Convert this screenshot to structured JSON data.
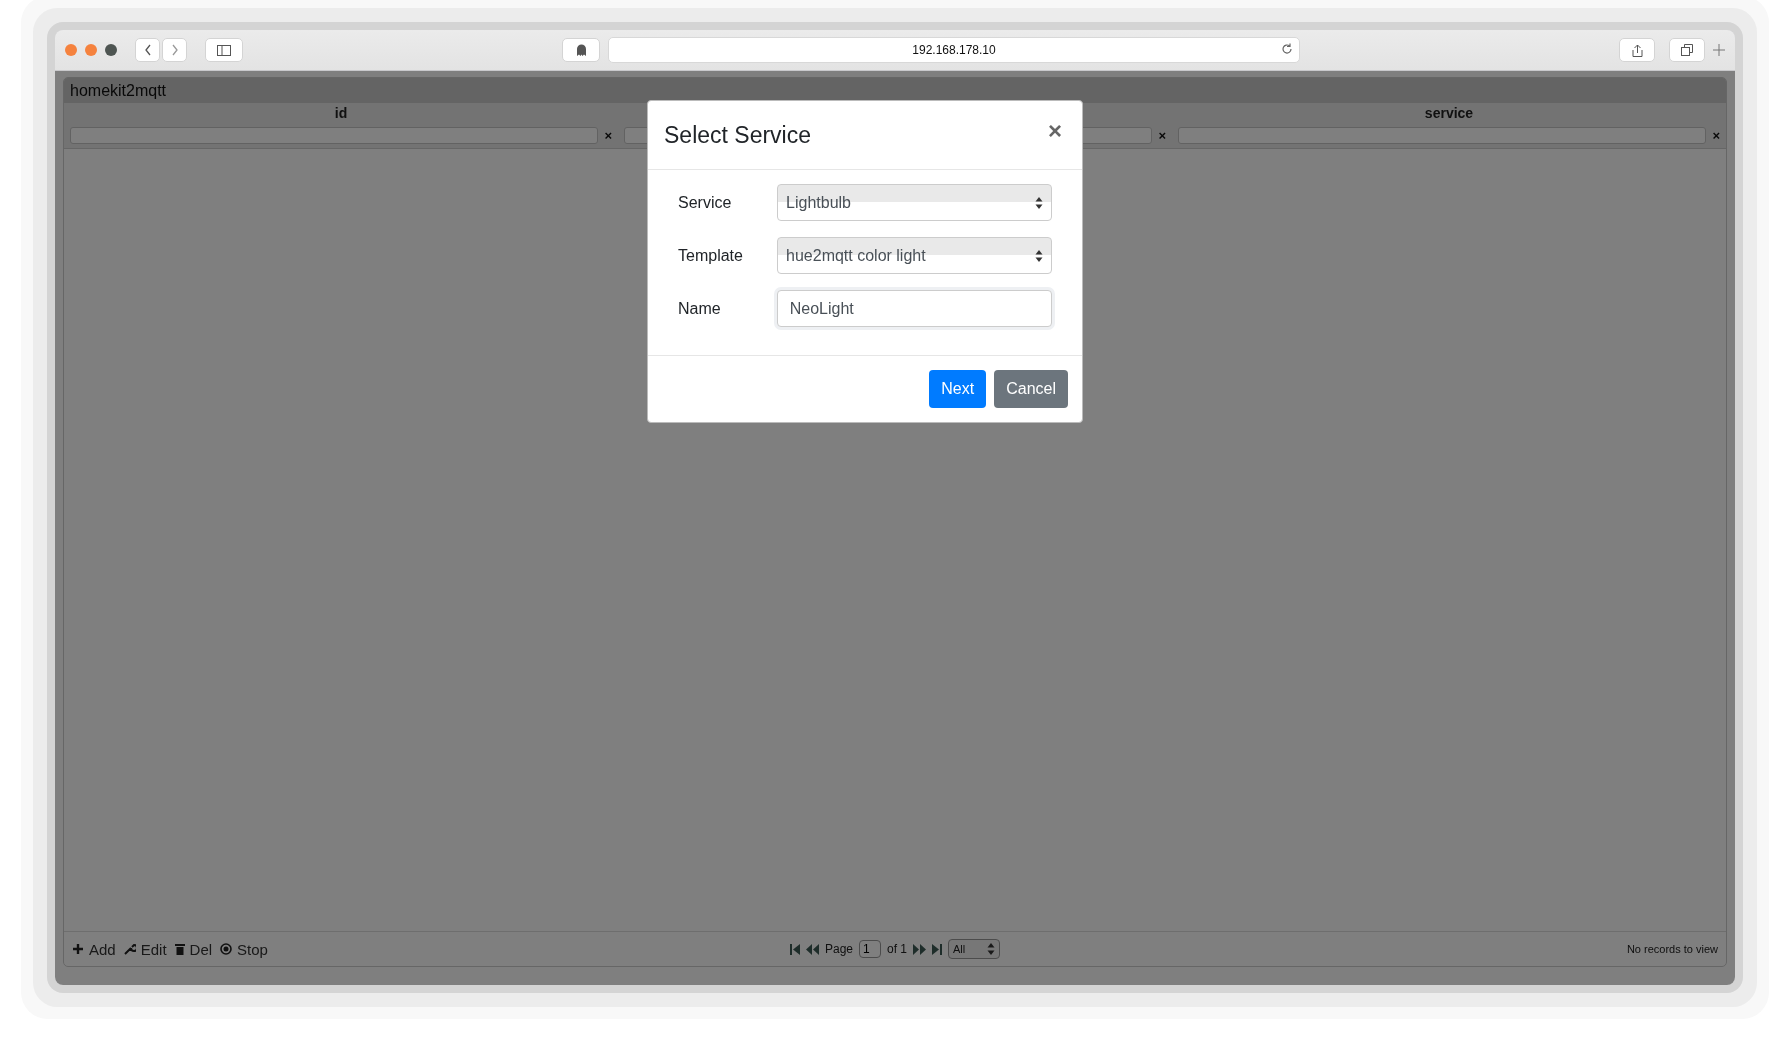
{
  "browser": {
    "url": "192.168.178.10"
  },
  "grid": {
    "caption": "homekit2mqtt",
    "columns": [
      {
        "label": "id",
        "clear": "×"
      },
      {
        "clear": "×"
      },
      {
        "label": "service",
        "clear": "×"
      }
    ],
    "actions": [
      {
        "kind": "add",
        "label": "Add"
      },
      {
        "kind": "edit",
        "label": "Edit"
      },
      {
        "kind": "delete",
        "label": "Del"
      },
      {
        "kind": "stop",
        "label": "Stop"
      }
    ],
    "pager": {
      "page_label": "Page",
      "page": "1",
      "of": "of 1",
      "rows": "All",
      "status": "No records to view"
    }
  },
  "dialog": {
    "title": "Select Service",
    "close": "×",
    "fields": [
      {
        "kind": "select",
        "label": "Service",
        "value": "Lightbulb"
      },
      {
        "kind": "select",
        "label": "Template",
        "value": "hue2mqtt color light"
      },
      {
        "kind": "text",
        "label": "Name",
        "value": "NeoLight"
      }
    ],
    "buttons": [
      {
        "kind": "primary",
        "label": "Next"
      },
      {
        "kind": "secondary",
        "label": "Cancel"
      }
    ]
  }
}
